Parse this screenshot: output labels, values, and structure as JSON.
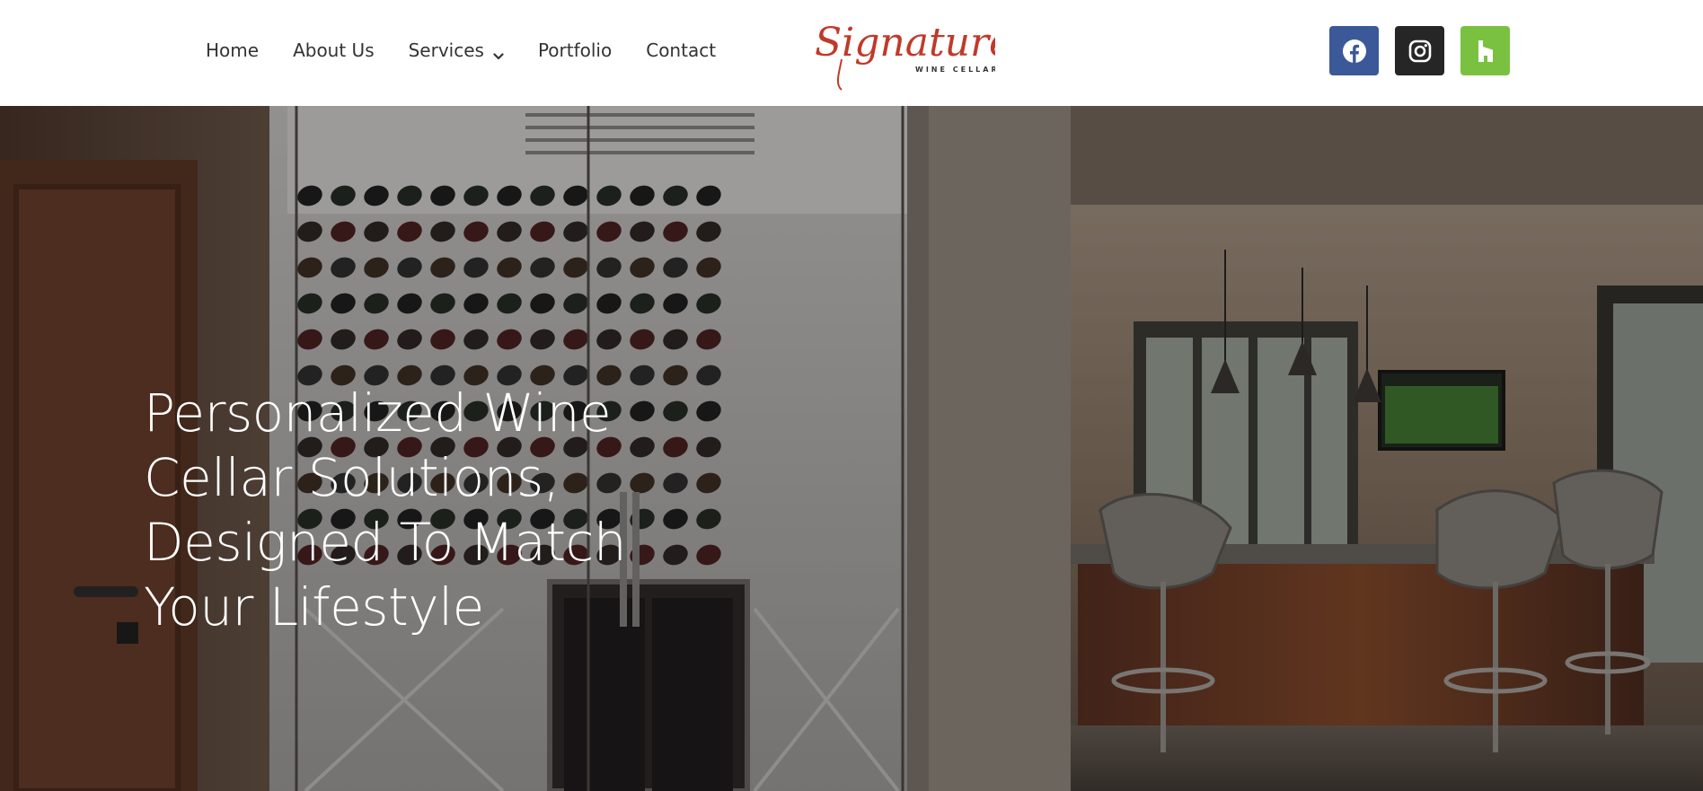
{
  "header": {
    "nav": [
      {
        "label": "Home"
      },
      {
        "label": "About Us"
      },
      {
        "label": "Services",
        "has_dropdown": true,
        "icon": "chevron-down-icon"
      },
      {
        "label": "Portfolio"
      },
      {
        "label": "Contact"
      }
    ],
    "logo": {
      "script": "Signature",
      "tagline": "WINE CELLARS",
      "color": "#c0392b"
    },
    "socials": [
      {
        "name": "facebook",
        "icon": "facebook-icon",
        "color": "#3b5998"
      },
      {
        "name": "instagram",
        "icon": "instagram-icon",
        "color": "#262626"
      },
      {
        "name": "houzz",
        "icon": "houzz-icon",
        "color": "#7ac142"
      }
    ]
  },
  "hero": {
    "headline_lines": [
      "Personalized Wine",
      "Cellar Solutions,",
      "Designed To Match",
      "Your Lifestyle"
    ]
  }
}
